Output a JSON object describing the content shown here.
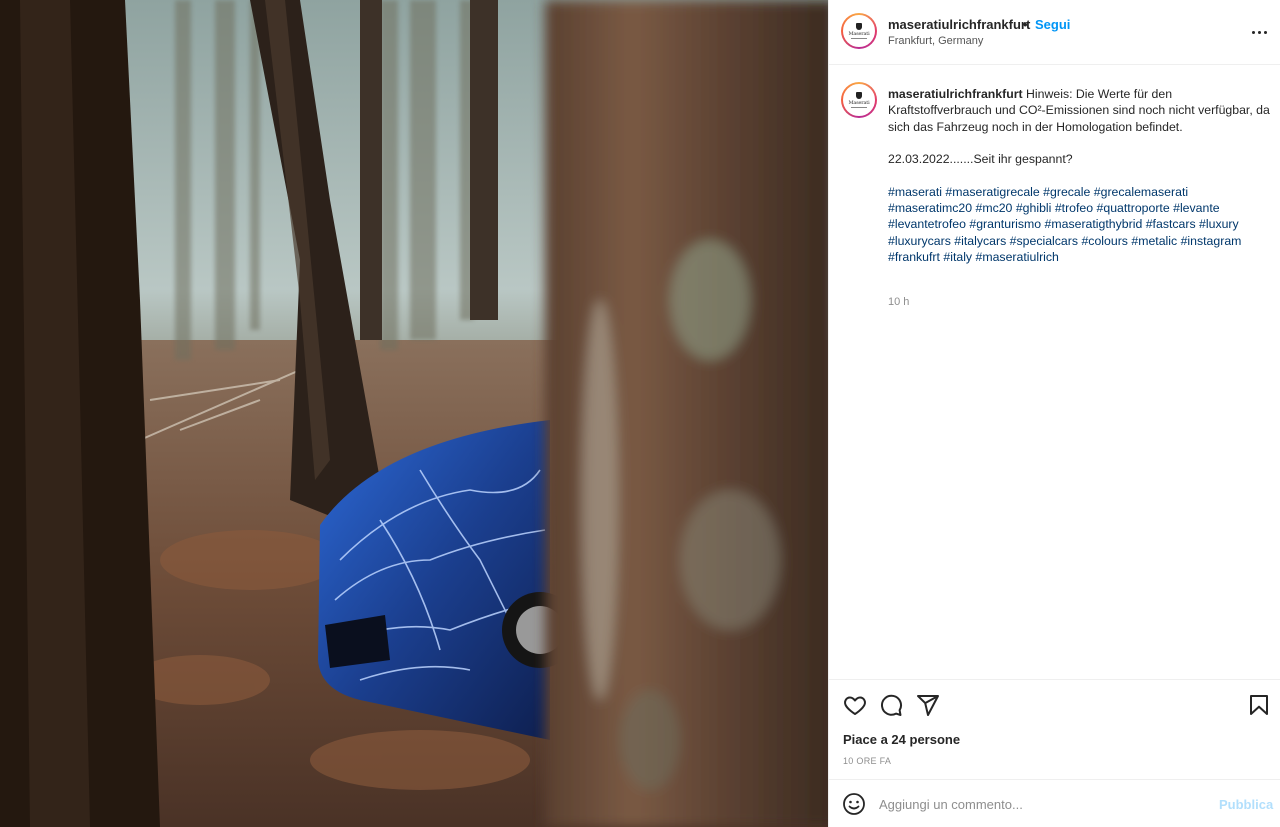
{
  "post": {
    "author": {
      "username": "maseratiulrichfrankfurt",
      "location": "Frankfurt, Germany",
      "avatar_text": "Maserati",
      "follow_label": "Segui",
      "separator": "•"
    },
    "photo": {
      "description_icon": "forest-maserati-photo",
      "dominant_colors": [
        "#4a3728",
        "#6b7a6e",
        "#1e4fa0",
        "#c9d6dc"
      ]
    },
    "caption": {
      "username": "maseratiulrichfrankfurt",
      "text_line": "Hinweis: Die Werte für den Kraftstoffverbrauch und CO²-Emissionen sind noch nicht verfügbar, da sich das Fahrzeug noch in der Homologation befindet.",
      "date_line": "22.03.2022.......Seit ihr gespannt?",
      "hashtags": [
        "#maserati",
        "#maseratigrecale",
        "#grecale",
        "#grecalemaserati",
        "#maseratimc20",
        "#mc20",
        "#ghibli",
        "#trofeo",
        "#quattroporte",
        "#levante",
        "#levantetrofeo",
        "#granturismo",
        "#maseratigthybrid",
        "#fastcars",
        "#luxury",
        "#luxurycars",
        "#italycars",
        "#specialcars",
        "#colours",
        "#metalic",
        "#instagram",
        "#frankufrt",
        "#italy",
        "#maseratiulrich"
      ],
      "time_ago": "10 h"
    },
    "actions": {
      "icons": [
        "heart-icon",
        "comment-icon",
        "share-icon",
        "bookmark-icon"
      ],
      "likes_label": "Piace a 24 persone",
      "date_label": "10 ORE FA"
    },
    "comment_box": {
      "placeholder": "Aggiungi un commento...",
      "publish_label": "Pubblica",
      "accent_color": "#0095f6",
      "publish_disabled_color": "#b2dffc"
    },
    "more_menu_icon": "more-options-icon"
  }
}
